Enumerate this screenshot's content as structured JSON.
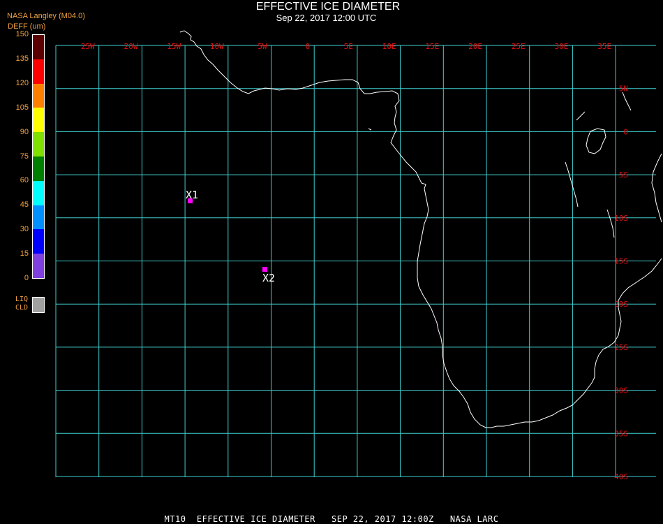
{
  "header": {
    "title": "EFFECTIVE ICE DIAMETER",
    "subtitle": "Sep 22, 2017 12:00 UTC",
    "brand": "NASA Langley (M04.0)"
  },
  "legend": {
    "title": "DEFF (um)",
    "ticks": [
      "150",
      "135",
      "120",
      "105",
      "90",
      "75",
      "60",
      "45",
      "30",
      "15",
      "0"
    ],
    "colors": [
      "#5a0000",
      "#ff0000",
      "#ff8000",
      "#ffff00",
      "#80e000",
      "#008000",
      "#00ffff",
      "#0090ff",
      "#0000ff",
      "#8040e0"
    ],
    "liquid_label_1": "LIQ",
    "liquid_label_2": "CLD",
    "liquid_color": "#a0a0a0"
  },
  "map": {
    "grid_color": "#40d0d0",
    "label_color": "#e01010",
    "coast_color": "#ffffff",
    "lon_labels": [
      "25W",
      "20W",
      "15W",
      "10W",
      "5W",
      "0",
      "5E",
      "10E",
      "15E",
      "20E",
      "25E",
      "30E",
      "35E"
    ],
    "lat_labels": [
      "5N",
      "0",
      "5S",
      "10S",
      "15S",
      "20S",
      "25S",
      "30S",
      "35S",
      "40S"
    ],
    "markers": [
      {
        "label": "X1",
        "color": "#ff00ff"
      },
      {
        "label": "X2",
        "color": "#ff00ff"
      }
    ]
  },
  "footer": {
    "text": "MT10  EFFECTIVE ICE DIAMETER   SEP 22, 2017 12:00Z   NASA LARC"
  }
}
